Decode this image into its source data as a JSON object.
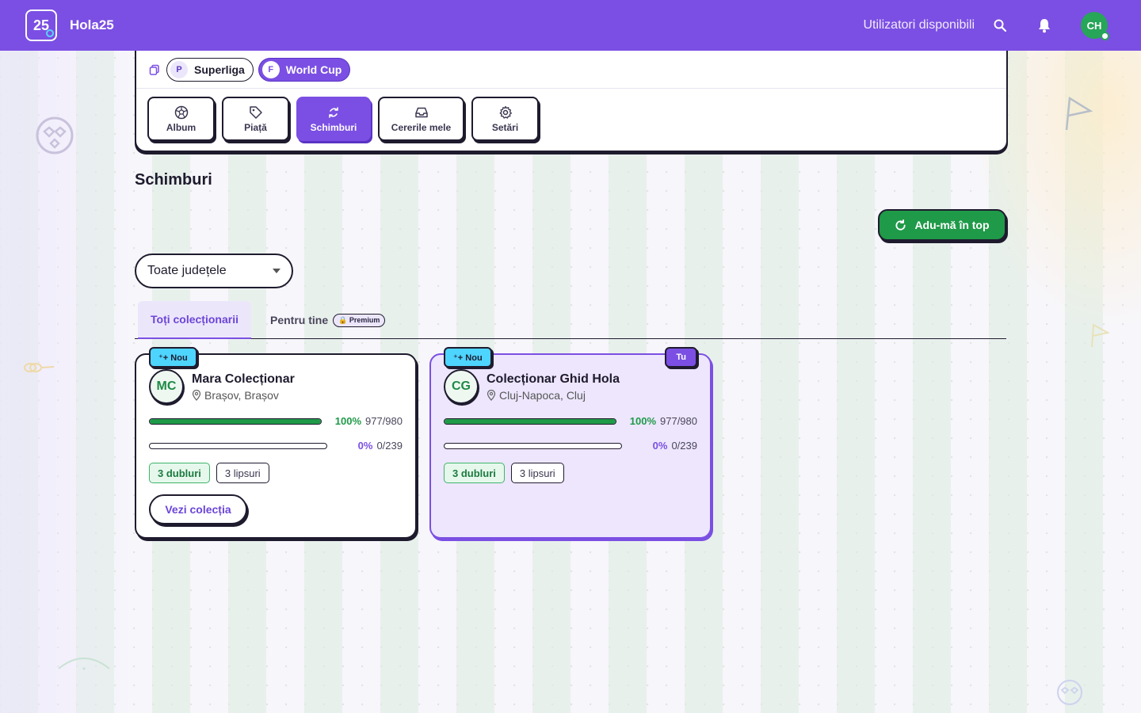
{
  "header": {
    "logo_text": "25",
    "brand": "Hola25",
    "available_users": "Utilizatori disponibili",
    "user_initials": "CH"
  },
  "leagues": [
    {
      "badge": "P",
      "label": "Superliga",
      "active": false
    },
    {
      "badge": "F",
      "label": "World Cup",
      "active": true
    }
  ],
  "nav_tabs": [
    {
      "label": "Album",
      "icon": "soccer-ball-icon"
    },
    {
      "label": "Piață",
      "icon": "tag-icon"
    },
    {
      "label": "Schimburi",
      "icon": "exchange-icon",
      "active": true
    },
    {
      "label": "Cererile mele",
      "icon": "inbox-icon"
    },
    {
      "label": "Setări",
      "icon": "gear-icon"
    }
  ],
  "page": {
    "title": "Schimburi",
    "top_button": "Adu-mă în top",
    "county_select": "Toate județele"
  },
  "segments": {
    "all": "Toți colecționarii",
    "for_you": "Pentru tine",
    "premium": "🔒 Premium"
  },
  "collectors": [
    {
      "new_tag": "⁺+ Nou",
      "initials": "MC",
      "name": "Mara Colecționar",
      "location": "Brașov, Brașov",
      "album_pct": "100%",
      "album_count": "977/980",
      "album_fill": 1.0,
      "special_pct": "0%",
      "special_count": "0/239",
      "special_fill": 0.0,
      "duplicates": "3 dubluri",
      "missing": "3 lipsuri",
      "view_button": "Vezi colecția",
      "is_you": false
    },
    {
      "new_tag": "⁺+ Nou",
      "you_tag": "Tu",
      "initials": "CG",
      "name": "Colecționar Ghid Hola",
      "location": "Cluj-Napoca, Cluj",
      "album_pct": "100%",
      "album_count": "977/980",
      "album_fill": 1.0,
      "special_pct": "0%",
      "special_count": "0/239",
      "special_fill": 0.0,
      "duplicates": "3 dubluri",
      "missing": "3 lipsuri",
      "is_you": true
    }
  ],
  "colors": {
    "brand": "#7b4fe3",
    "success": "#1f9a48",
    "new_tag": "#4dd4ff"
  }
}
